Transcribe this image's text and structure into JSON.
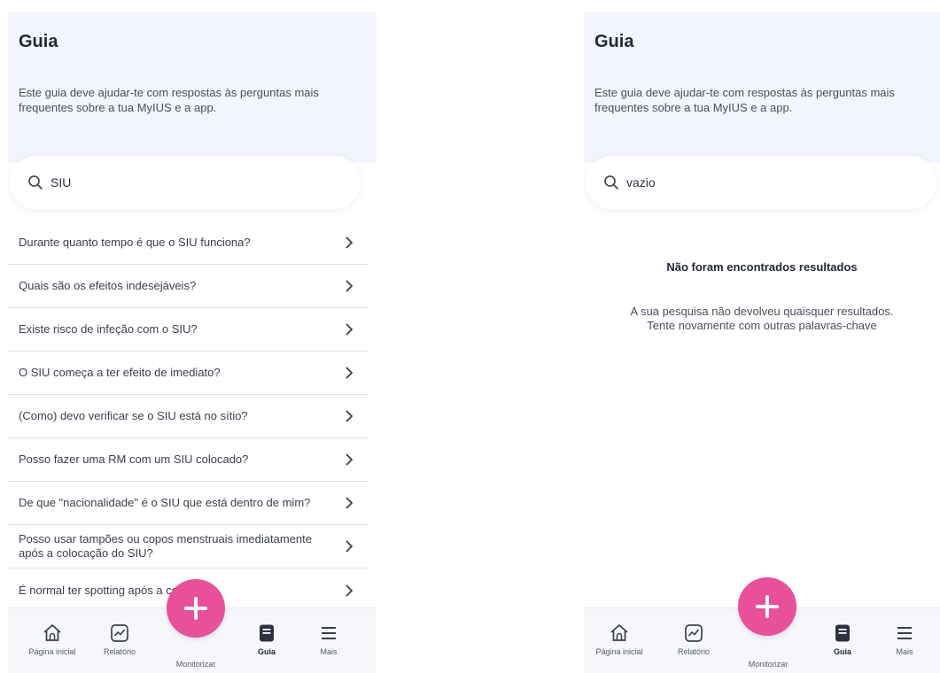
{
  "left": {
    "title": "Guia",
    "subtitle": "Este guia deve ajudar-te com respostas às perguntas mais frequentes sobre a tua MyIUS e a app.",
    "search_value": "SIU",
    "results": [
      "Durante quanto tempo é que o SIU funciona?",
      "Quais são os efeitos indesejáveis?",
      "Existe risco de infeção com o SIU?",
      "O SIU começa a ter efeito de imediato?",
      "(Como) devo verificar se o SIU está no sítio?",
      "Posso fazer uma RM com um SIU colocado?",
      "De que \"nacionalidade\" é o SIU que está dentro de mim?",
      "Posso usar tampões ou copos menstruais imediatamente após a colocação do SIU?",
      "É normal ter spotting após a colocação"
    ]
  },
  "right": {
    "title": "Guia",
    "subtitle": "Este guia deve ajudar-te com respostas às perguntas mais frequentes sobre a tua MyIUS e a app.",
    "search_value": "vazio",
    "empty_title": "Não foram encontrados resultados",
    "empty_text": "A sua pesquisa não devolveu quaisquer resultados. Tente novamente com outras palavras-chave"
  },
  "tabs": {
    "home": "Página inicial",
    "report": "Relatório",
    "monitor": "Monitorizar",
    "guide": "Guia",
    "more": "Mais"
  },
  "icons": [
    "search-icon",
    "chevron-right-icon",
    "home-icon",
    "chart-icon",
    "plus-icon",
    "book-icon",
    "menu-icon"
  ],
  "colors": {
    "accent": "#e8509a",
    "header_bg": "#f2f5fb",
    "tabbar_bg": "#f6f7fa"
  }
}
